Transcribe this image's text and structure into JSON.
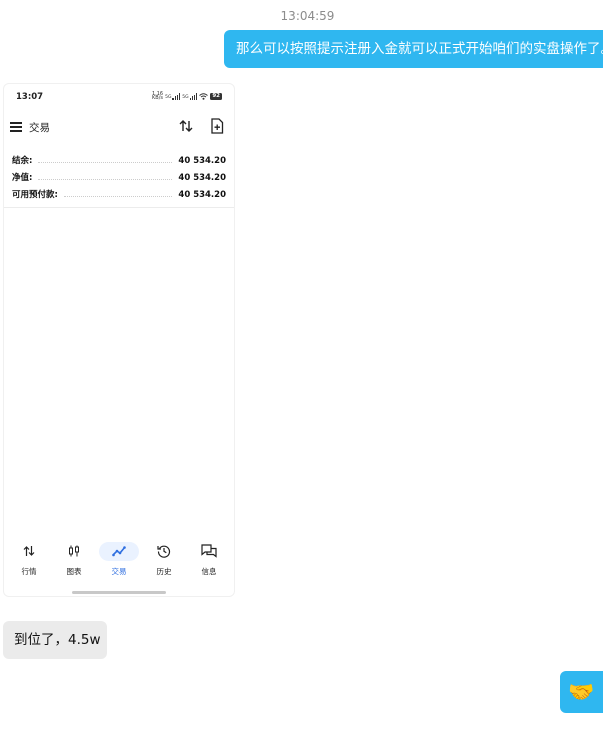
{
  "chat": {
    "timestamp": "13:04:59",
    "outgoing_message": "那么可以按照提示注册入金就可以正式开始咱们的实盘操作了。",
    "incoming_message": "到位了，4.5w",
    "outgoing_emoji": "🤝"
  },
  "phone": {
    "status_time": "13:07",
    "network_speed_top": "1.16",
    "network_speed_bottom": "KB/s",
    "network_5g_1": "5G",
    "network_5g_2": "5G",
    "battery": "92",
    "app_title": "交易",
    "balance_rows": [
      {
        "label": "结余:",
        "value": "40 534.20"
      },
      {
        "label": "净值:",
        "value": "40 534.20"
      },
      {
        "label": "可用预付款:",
        "value": "40 534.20"
      }
    ],
    "nav": [
      {
        "label": "行情",
        "icon": "quotes-arrows-icon"
      },
      {
        "label": "图表",
        "icon": "candlestick-chart-icon"
      },
      {
        "label": "交易",
        "icon": "trade-trend-icon",
        "active": true
      },
      {
        "label": "历史",
        "icon": "history-clock-icon"
      },
      {
        "label": "信息",
        "icon": "messages-icon"
      }
    ]
  },
  "colors": {
    "outgoing_bubble": "#2fb7f0",
    "incoming_bubble": "#ebebeb",
    "active_tab": "#2f6fe0"
  }
}
